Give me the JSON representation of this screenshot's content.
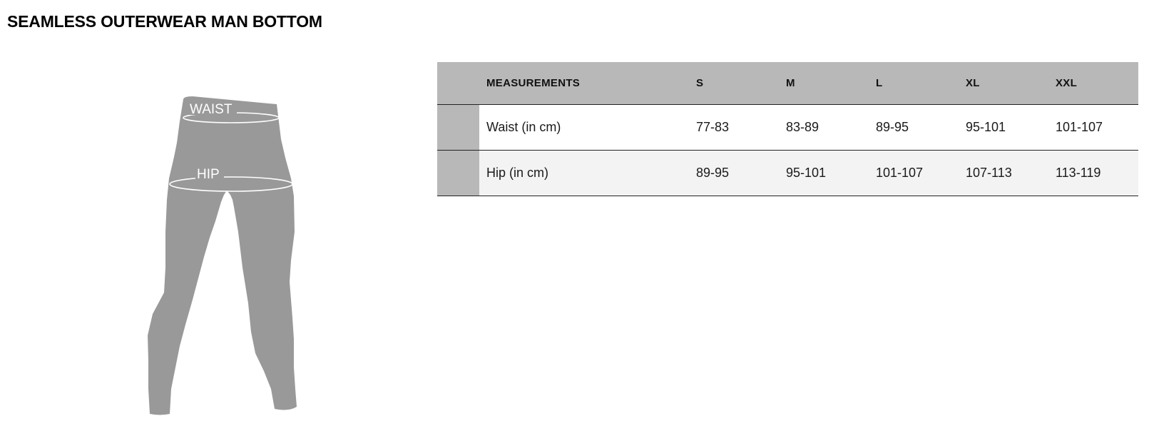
{
  "title": "SEAMLESS OUTERWEAR MAN BOTTOM",
  "figure": {
    "waist_label": "WAIST",
    "hip_label": "HIP",
    "garment_color": "#999999",
    "line_color": "#ffffff"
  },
  "table": {
    "headers": {
      "measurements": "MEASUREMENTS",
      "sizes": [
        "S",
        "M",
        "L",
        "XL",
        "XXL"
      ]
    },
    "rows": [
      {
        "label": "Waist (in cm)",
        "values": [
          "77-83",
          "83-89",
          "89-95",
          "95-101",
          "101-107"
        ]
      },
      {
        "label": "Hip (in cm)",
        "values": [
          "89-95",
          "95-101",
          "101-107",
          "107-113",
          "113-119"
        ]
      }
    ],
    "colors": {
      "header_bg": "#b8b8b8",
      "row_alt_bg": "#f3f3f3",
      "border": "#222222"
    }
  }
}
